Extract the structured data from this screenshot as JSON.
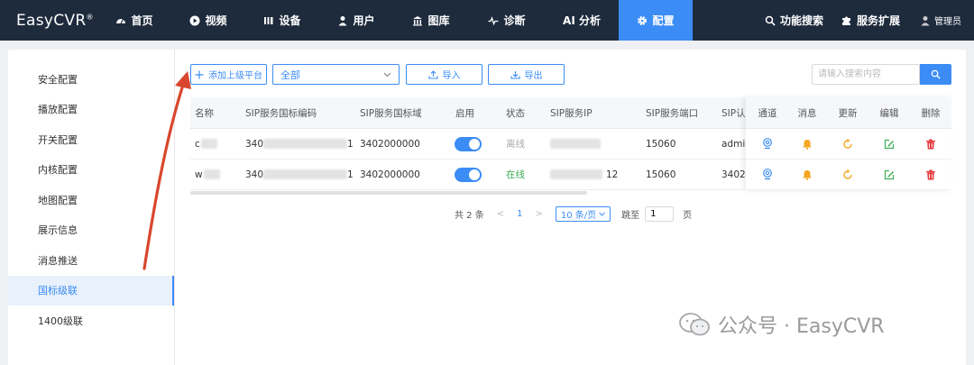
{
  "app": {
    "logo": "EasyCVR",
    "logo_mark": "®"
  },
  "nav": {
    "items": [
      {
        "label": "首页",
        "icon": "dashboard-icon"
      },
      {
        "label": "视频",
        "icon": "play-icon"
      },
      {
        "label": "设备",
        "icon": "bars-icon"
      },
      {
        "label": "用户",
        "icon": "user-icon"
      },
      {
        "label": "图库",
        "icon": "building-icon"
      },
      {
        "label": "诊断",
        "icon": "pulse-icon"
      },
      {
        "label": "AI 分析",
        "icon": ""
      },
      {
        "label": "配置",
        "icon": "gear-icon",
        "active": true
      }
    ],
    "right": [
      {
        "label": "功能搜索",
        "icon": "search-icon"
      },
      {
        "label": "服务扩展",
        "icon": "puzzle-icon"
      }
    ],
    "user": "管理员"
  },
  "sidebar": {
    "items": [
      {
        "label": "安全配置"
      },
      {
        "label": "播放配置"
      },
      {
        "label": "开关配置"
      },
      {
        "label": "内核配置"
      },
      {
        "label": "地图配置"
      },
      {
        "label": "展示信息"
      },
      {
        "label": "消息推送"
      },
      {
        "label": "国标级联",
        "active": true
      },
      {
        "label": "1400级联"
      }
    ]
  },
  "toolbar": {
    "add_label": "添加上级平台",
    "select_value": "全部",
    "import_label": "导入",
    "export_label": "导出",
    "search_placeholder": "请输入搜索内容"
  },
  "table": {
    "headers": {
      "name": "名称",
      "sip_code": "SIP服务国标编码",
      "sip_domain": "SIP服务国标域",
      "enable": "启用",
      "status": "状态",
      "sip_ip": "SIP服务IP",
      "sip_port": "SIP服务端口",
      "sip_auth": "SIP认",
      "channel": "通道",
      "message": "消息",
      "update": "更新",
      "edit": "编辑",
      "delete": "删除"
    },
    "rows": [
      {
        "name": "c",
        "code_prefix": "340",
        "code_suffix": "1",
        "domain": "3402000000",
        "status": "离线",
        "ip_suffix": "",
        "port": "15060",
        "auth": "admi"
      },
      {
        "name": "w",
        "code_prefix": "340",
        "code_suffix": "1",
        "domain": "3402000000",
        "status": "在线",
        "ip_suffix": "12",
        "port": "15060",
        "auth": "3402"
      }
    ]
  },
  "pagination": {
    "total": "共 2 条",
    "prev": "<",
    "page": "1",
    "next": ">",
    "page_size": "10 条/页",
    "goto_label": "跳至",
    "goto_value": "1",
    "page_unit": "页"
  },
  "watermark": {
    "text": "公众号 · EasyCVR"
  },
  "colors": {
    "accent": "#3b8cf5",
    "nav_bg": "#1e2b3d",
    "online": "#3fae57",
    "bell": "#f5a623",
    "refresh": "#f5a623",
    "edit": "#3fae57",
    "delete": "#e4393c",
    "arrow": "#d9462d"
  }
}
